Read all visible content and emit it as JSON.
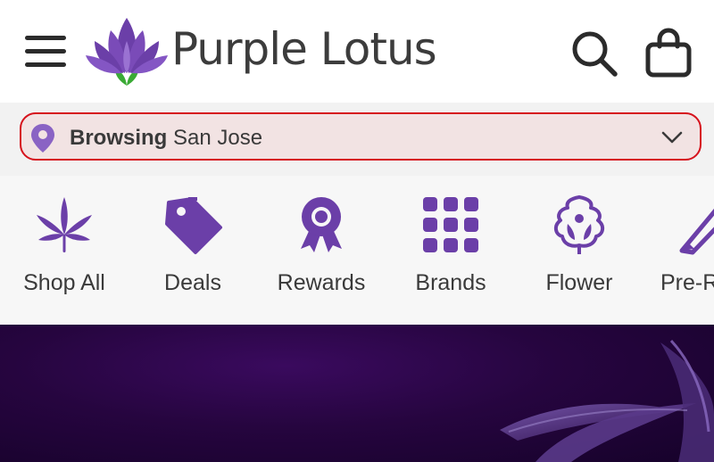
{
  "header": {
    "brand_name": "Purple Lotus",
    "icons": {
      "menu": "hamburger-menu-icon",
      "search": "search-icon",
      "cart": "shopping-bag-icon",
      "logo": "lotus-logo-icon"
    }
  },
  "location": {
    "prefix": "Browsing",
    "city": "San Jose",
    "icons": {
      "pin": "location-pin-icon",
      "chevron": "chevron-down-icon"
    }
  },
  "categories": [
    {
      "label": "Shop All",
      "icon": "cannabis-leaf-icon"
    },
    {
      "label": "Deals",
      "icon": "price-tag-icon"
    },
    {
      "label": "Rewards",
      "icon": "award-ribbon-icon"
    },
    {
      "label": "Brands",
      "icon": "grid-icon"
    },
    {
      "label": "Flower",
      "icon": "flower-bud-icon"
    },
    {
      "label": "Pre-Rolls",
      "icon": "pre-roll-icon"
    }
  ],
  "colors": {
    "brand_purple": "#6b3fa8",
    "logo_green": "#3aaa35",
    "highlight_border": "#d6121c",
    "highlight_fill": "#f2e3e3",
    "text_dark": "#3a3a3a",
    "hero_dark": "#1e0435"
  }
}
